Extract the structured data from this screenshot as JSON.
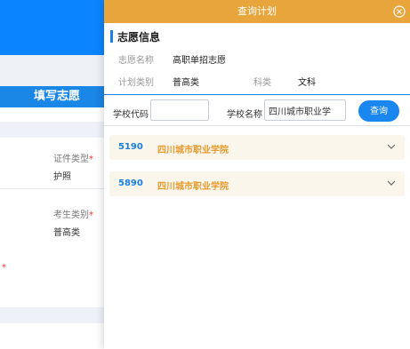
{
  "background": {
    "header": "填写志愿",
    "fields": [
      {
        "label": "证件类型",
        "value": "护照"
      },
      {
        "label": "考生类别",
        "value": "普高类"
      }
    ],
    "required_star": "*"
  },
  "panel": {
    "title": "查询计划",
    "section_title": "志愿信息",
    "info": {
      "wish_name_label": "志愿名称",
      "wish_name_value": "高职单招志愿",
      "plan_type_label": "计划类别",
      "plan_type_value": "普高类",
      "subject_label": "科类",
      "subject_value": "文科"
    },
    "search": {
      "school_code_label": "学校代码",
      "school_code_value": "",
      "school_name_label": "学校名称",
      "school_name_value": "四川城市职业学",
      "button_label": "查询"
    },
    "results": [
      {
        "code": "5190",
        "name": "四川城市职业学院"
      },
      {
        "code": "5890",
        "name": "四川城市职业学院"
      }
    ]
  },
  "colors": {
    "titlebar": "#e8a53c",
    "accent_blue": "#1a7fe0",
    "result_name": "#e89a2c",
    "card_bg": "#fbf6ec"
  }
}
